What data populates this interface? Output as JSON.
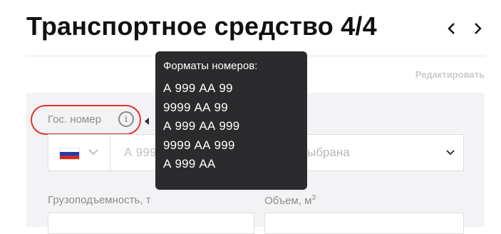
{
  "header": {
    "title": "Транспортное средство 4/4",
    "prev_icon": "chevron-left-icon",
    "next_icon": "chevron-right-icon"
  },
  "edit_link": "Редактировать",
  "plate": {
    "label": "Гос. номер",
    "info_icon": "info-icon",
    "info_glyph": "i",
    "country_flag": "russia-flag-icon",
    "placeholder_visible": "А 999"
  },
  "region": {
    "value_visible": "ыбрана",
    "icon": "chevron-down-icon"
  },
  "capacity": {
    "label": "Грузоподъемность, т"
  },
  "volume": {
    "label": "Объем, м",
    "unit_power": "3"
  },
  "tooltip": {
    "title": "Форматы номеров:",
    "formats": [
      "А 999 АА 99",
      "9999 АА 99",
      "А 999 АА 999",
      "9999 АА 999",
      "А 999 АА"
    ]
  },
  "colors": {
    "highlight": "#e5322d",
    "tooltip_bg": "#2b2b2d",
    "panel_bg": "#f3f3f5",
    "flag": [
      "#ffffff",
      "#1c3fb0",
      "#d52b1e"
    ]
  }
}
